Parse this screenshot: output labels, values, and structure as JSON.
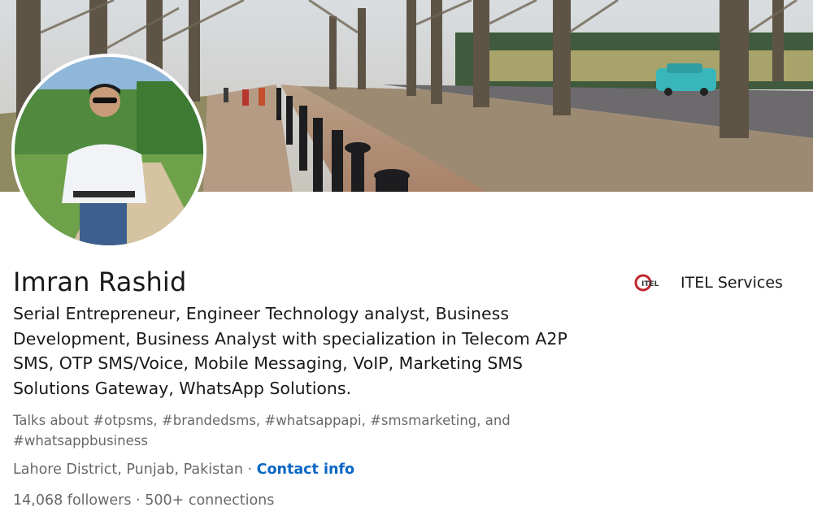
{
  "profile": {
    "name": "Imran Rashid",
    "headline": "Serial Entrepreneur, Engineer Technology analyst, Business Development, Business Analyst with specialization in Telecom A2P SMS, OTP SMS/Voice, Mobile Messaging, VoIP, Marketing SMS Solutions Gateway, WhatsApp Solutions.",
    "talks_about": "Talks about #otpsms, #brandedsms, #whatsappapi, #smsmarketing, and #whatsappbusiness",
    "location": "Lahore District, Punjab, Pakistan",
    "separator": " · ",
    "contact_label": "Contact info",
    "followers_count": "14,068",
    "followers_label": " followers",
    "connections_sep": "  · ",
    "connections_count": "500+",
    "connections_label": " connections"
  },
  "company": {
    "name": "ITEL Services",
    "logo_text": "ITEL",
    "logo_icon": "itel-logo-icon"
  },
  "colors": {
    "link": "#0a66c2",
    "logo_red": "#c0272d"
  }
}
